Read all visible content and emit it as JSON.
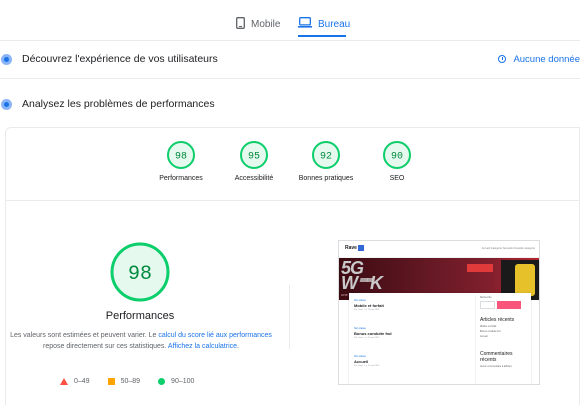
{
  "tabs": [
    {
      "label": "Mobile",
      "icon": "phone-icon",
      "active": false
    },
    {
      "label": "Bureau",
      "icon": "laptop-icon",
      "active": true
    }
  ],
  "accent": "#1a73e8",
  "field_data": {
    "title": "Découvrez l'expérience de vos utilisateurs",
    "no_data": "Aucune donnée"
  },
  "lab_data": {
    "title": "Analysez les problèmes de performances"
  },
  "scores": [
    {
      "value": "98",
      "label": "Performances"
    },
    {
      "value": "95",
      "label": "Accessibilité"
    },
    {
      "value": "92",
      "label": "Bonnes pratiques"
    },
    {
      "value": "90",
      "label": "SEO"
    }
  ],
  "score_color": "#0cce6b",
  "detail": {
    "score": "98",
    "title": "Performances",
    "desc_1": "Les valeurs sont estimées et peuvent varier. Le ",
    "desc_link_1": "calcul du score lié aux performances",
    "desc_2": " repose directement sur ces statistiques. ",
    "desc_link_2": "Affichez la calculatrice",
    "desc_3": "."
  },
  "legend": [
    {
      "range": "0–49",
      "color": "#ff4e42",
      "shape": "triangle"
    },
    {
      "range": "50–89",
      "color": "#ffa400",
      "shape": "square"
    },
    {
      "range": "90–100",
      "color": "#0cce6b",
      "shape": "circle"
    }
  ],
  "screenshot": {
    "site_name": "Rave",
    "hero_title_1": "5G",
    "hero_title_2": "W",
    "hero_title_3": "K",
    "hero_subtitle": "une semaine pour s'équiper !",
    "nav": "Accueil    Catégorie Nouvelle    Nouvelle catégorie",
    "posts": [
      {
        "cat": "Non classé",
        "title": "Mobile et forfait",
        "meta": "Par Gael · Le 11 mai 2021"
      },
      {
        "cat": "Non classé",
        "title": "Bonus conduite fnd",
        "meta": "Par Gael · Le 11 mai 2021"
      },
      {
        "cat": "Non classé",
        "title": "Accueil",
        "meta": "Par Gael · Le 11 mai 2021"
      }
    ],
    "aside_search": "Recherche",
    "aside_recent_title": "Articles récents",
    "aside_recent_items": [
      "Mobile et forfait",
      "Bonus conduite fnd",
      "Accueil"
    ],
    "aside_comments_title": "Commentaires récents",
    "aside_comments_item": "Aucun commentaire à afficher"
  }
}
